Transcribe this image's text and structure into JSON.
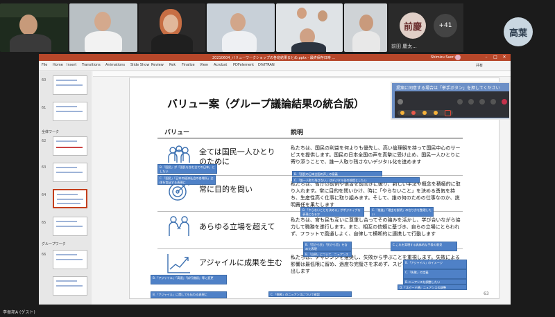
{
  "participants": {
    "initials_tile": {
      "initials": "前慶",
      "name": "前田 慶太..."
    },
    "more_count": "+41",
    "avatar_tile": {
      "initials": "高葉"
    },
    "self_name": "李振邦A (ゲスト)"
  },
  "window": {
    "title": "20210604_バリューワークショップの各班結果まとめ.pptx - 最終保存日時 ...",
    "user": "Shimizu Saori",
    "accent": "#b7472a"
  },
  "menu": [
    "File",
    "Home",
    "Insert",
    "Transitions",
    "Animations",
    "Slide Show",
    "Review",
    "Rek",
    "Finalize",
    "View",
    "Acrobat",
    "PDFelement",
    "DIVITRAN"
  ],
  "share": "共有",
  "thumbnails": {
    "sections": [
      "全体ワーク",
      "グループワーク"
    ],
    "numbers": [
      "60",
      "61",
      "62",
      "63",
      "64",
      "65",
      "66"
    ]
  },
  "slide": {
    "title": "バリュー案（グループ議論結果の統合版）",
    "col_value": "バリュー",
    "col_desc": "説明",
    "page_number": "63",
    "rows": [
      {
        "value": "全ては国民一人ひとりのために",
        "value_l1": "全ては国民一人ひとり",
        "value_l2": "のために",
        "icon": "people-icon",
        "desc": "私たちは、国民の利益を何よりも優先し、高い倫理観を持って国民中心のサービスを提供します。国民の日本全国の声を真摯に受け止め、国民一人ひとりに寄り添うことで、誰一人取り残さないデジタル化を進めます"
      },
      {
        "value": "常に目的を問い",
        "icon": "target-icon",
        "desc": "私たちは、省庁の前例や慣習を前向きに破り、新しい手法や概念を積極的に取り入れます。常に目的を問いかけ、時に「やらないこと」を決める勇気を持ち、生産性高く仕事に取り組みます。そして、誰の何のための仕事なのか、説明責任を果たします"
      },
      {
        "value": "あらゆる立場を超えて",
        "icon": "handshake-icon",
        "desc": "私たちは、官も民も互いに尊重し合ってその強みを活かし、学び合いながら協力して職務を遂行します。また、相互の信頼に基づき、自らの立場にとらわれず、フラットで風通しよく、自律して横断的に連携して行動します"
      },
      {
        "value": "アジャイルに成果を生む",
        "icon": "growth-chart-icon",
        "desc": "私たちは、チャレンジを推奨し、失敗から学ぶことを重視します。失敗による影響は最低限に留め、過度な完璧さを求めず、スピード感を持って成果を生み出します"
      }
    ]
  },
  "comments": [
    "B.「国民」が「国民を含む全ての日本」にしたい",
    "B.「国民の日本全国の声」の意義",
    "C.「国民」「日本の経済社会の各場所」全体を包括する表現に",
    "C.「誰一人取り残さない」はデジタル化の前提としたい",
    "B.「やらないことを決める」がポジティブな表現になるか",
    "C.「推進」「理由を説明」の在り方を整理したい",
    "B.「官から民」「民から官」を含めた表現",
    "B.「自律」について、ニュアンスを確認",
    "C.これを実現する具体的な手段の意見",
    "B.「アジャイル」のイメージ",
    "C.「失敗」の定義",
    "D.ニュアンスを調整したい",
    "B.「アジャイル」「高速」「試行錯誤」等に変更",
    "B.「アジャイル」に関しても伝わる表現に",
    "C.「挑戦」のニュアンスについて確認",
    "D.「スピード感」ニュアンスの調整"
  ],
  "reaction_bar": {
    "prompt": "提案に同意する場合は「挙手ボタン」を押してください"
  }
}
